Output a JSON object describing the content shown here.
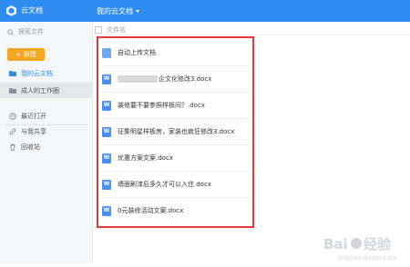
{
  "app": {
    "name": "云文档",
    "nav_title": "我的云文档"
  },
  "sidebar": {
    "search_placeholder": "搜索文件",
    "new_button": "新建",
    "items": [
      {
        "label": "我的云文档",
        "active": true
      },
      {
        "label": "成人的工作圈",
        "selected": true
      },
      {
        "label": "最近打开"
      },
      {
        "label": "与我共享"
      },
      {
        "label": "回收站"
      }
    ]
  },
  "list": {
    "header": "文件名",
    "files": [
      {
        "name": "自动上传文档",
        "type": "folder"
      },
      {
        "name": "企文化修改3.docx",
        "type": "word",
        "partially_hidden": true
      },
      {
        "name": "装修要不要参照样板间？.docx",
        "type": "word"
      },
      {
        "name": "征集明星样板房，家装也疯狂修改3.docx",
        "type": "word"
      },
      {
        "name": "优惠方案文案.docx",
        "type": "word"
      },
      {
        "name": "墙面刷漆后多久才可以入住.docx",
        "type": "word"
      },
      {
        "name": "0元装修活动文案.docx",
        "type": "word"
      }
    ]
  },
  "colors": {
    "topbar": "#2f8cf0",
    "new_button": "#f6a623",
    "highlight_frame": "#e23b3b",
    "word_icon": "#4a8ff7"
  }
}
